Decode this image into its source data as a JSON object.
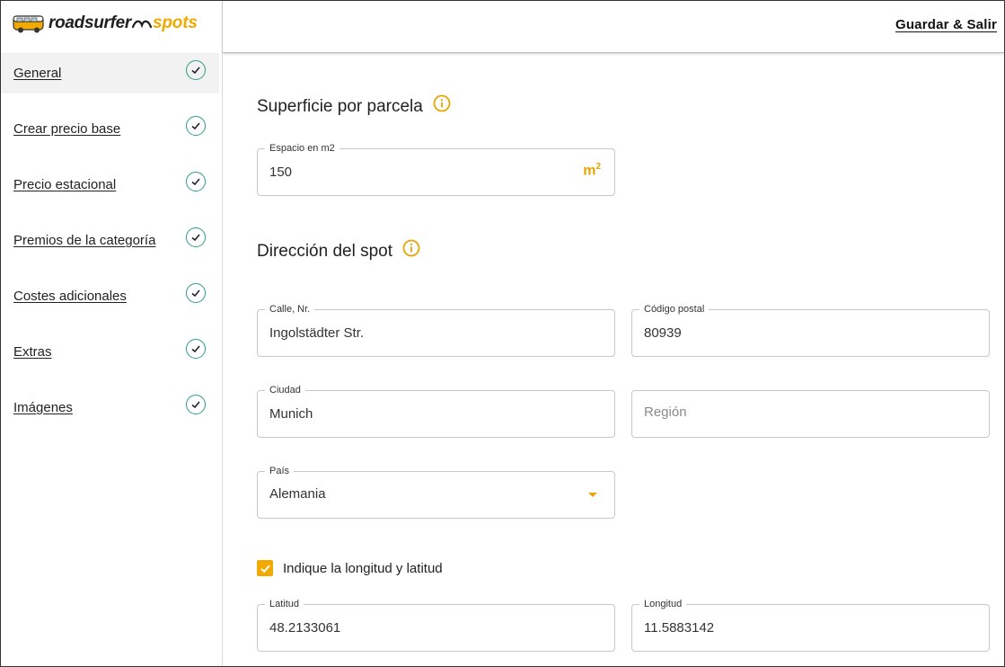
{
  "brand": {
    "name": "roadsurfer",
    "suffix": "spots"
  },
  "header": {
    "save_label": "Guardar & Salir"
  },
  "sidebar": {
    "items": [
      {
        "label": "General",
        "active": true,
        "completed": true
      },
      {
        "label": "Crear precio base",
        "completed": true
      },
      {
        "label": "Precio estacional",
        "completed": true
      },
      {
        "label": "Premios de la categoría",
        "completed": true
      },
      {
        "label": "Costes adicionales",
        "completed": true
      },
      {
        "label": "Extras",
        "completed": true
      },
      {
        "label": "Imágenes",
        "completed": true
      }
    ]
  },
  "surface": {
    "title": "Superficie por parcela",
    "field_label": "Espacio en m2",
    "value": "150",
    "unit": "m",
    "unit_exp": "2"
  },
  "address": {
    "title": "Dirección del spot",
    "street": {
      "label": "Calle, Nr.",
      "value": "Ingolstädter Str."
    },
    "postal": {
      "label": "Código postal",
      "value": "80939"
    },
    "city": {
      "label": "Ciudad",
      "value": "Munich"
    },
    "region": {
      "placeholder": "Región"
    },
    "country": {
      "label": "País",
      "value": "Alemania"
    },
    "coords_checkbox": {
      "label": "Indique la longitud y latitud",
      "checked": true
    },
    "latitude": {
      "label": "Latitud",
      "value": "48.2133061"
    },
    "longitude": {
      "label": "Longitud",
      "value": "11.5883142"
    }
  },
  "colors": {
    "accent": "#f2a900",
    "check_green": "#2c9d80",
    "active_bg": "#f2f2f2"
  }
}
